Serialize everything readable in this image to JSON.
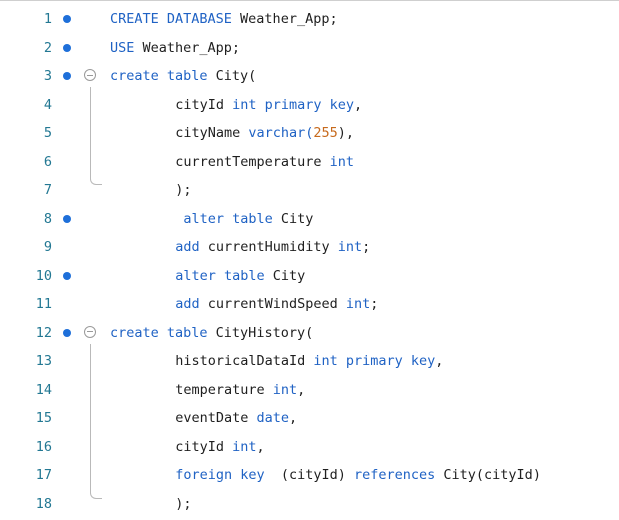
{
  "editor": {
    "lines": [
      {
        "num": "1",
        "dot": true,
        "fold": false,
        "indent": 0,
        "tokens": [
          {
            "t": "CREATE DATABASE",
            "k": "kw"
          },
          {
            "t": " Weather_App;",
            "k": "id"
          }
        ]
      },
      {
        "num": "2",
        "dot": true,
        "fold": false,
        "indent": 0,
        "tokens": [
          {
            "t": "USE",
            "k": "kw"
          },
          {
            "t": " Weather_App;",
            "k": "id"
          }
        ]
      },
      {
        "num": "3",
        "dot": true,
        "fold": true,
        "indent": 0,
        "tokens": [
          {
            "t": "create table",
            "k": "kw"
          },
          {
            "t": " City(",
            "k": "id"
          }
        ]
      },
      {
        "num": "4",
        "dot": false,
        "fold": false,
        "indent": 8,
        "tokens": [
          {
            "t": "cityId ",
            "k": "id"
          },
          {
            "t": "int primary key",
            "k": "kw"
          },
          {
            "t": ",",
            "k": "id"
          }
        ]
      },
      {
        "num": "5",
        "dot": false,
        "fold": false,
        "indent": 8,
        "tokens": [
          {
            "t": "cityName ",
            "k": "id"
          },
          {
            "t": "varchar(",
            "k": "kw"
          },
          {
            "t": "255",
            "k": "num"
          },
          {
            "t": "),",
            "k": "id"
          }
        ]
      },
      {
        "num": "6",
        "dot": false,
        "fold": false,
        "indent": 8,
        "tokens": [
          {
            "t": "currentTemperature ",
            "k": "id"
          },
          {
            "t": "int",
            "k": "kw"
          }
        ]
      },
      {
        "num": "7",
        "dot": false,
        "fold": false,
        "indent": 8,
        "tokens": [
          {
            "t": ");",
            "k": "id"
          }
        ]
      },
      {
        "num": "8",
        "dot": true,
        "fold": false,
        "indent": 9,
        "tokens": [
          {
            "t": "alter table",
            "k": "kw"
          },
          {
            "t": " City",
            "k": "id"
          }
        ]
      },
      {
        "num": "9",
        "dot": false,
        "fold": false,
        "indent": 8,
        "tokens": [
          {
            "t": "add",
            "k": "kw"
          },
          {
            "t": " currentHumidity ",
            "k": "id"
          },
          {
            "t": "int",
            "k": "kw"
          },
          {
            "t": ";",
            "k": "id"
          }
        ]
      },
      {
        "num": "10",
        "dot": true,
        "fold": false,
        "indent": 8,
        "tokens": [
          {
            "t": "alter table",
            "k": "kw"
          },
          {
            "t": " City",
            "k": "id"
          }
        ]
      },
      {
        "num": "11",
        "dot": false,
        "fold": false,
        "indent": 8,
        "tokens": [
          {
            "t": "add",
            "k": "kw"
          },
          {
            "t": " currentWindSpeed ",
            "k": "id"
          },
          {
            "t": "int",
            "k": "kw"
          },
          {
            "t": ";",
            "k": "id"
          }
        ]
      },
      {
        "num": "12",
        "dot": true,
        "fold": true,
        "indent": 0,
        "tokens": [
          {
            "t": "create table",
            "k": "kw"
          },
          {
            "t": " CityHistory(",
            "k": "id"
          }
        ]
      },
      {
        "num": "13",
        "dot": false,
        "fold": false,
        "indent": 8,
        "tokens": [
          {
            "t": "historicalDataId ",
            "k": "id"
          },
          {
            "t": "int primary key",
            "k": "kw"
          },
          {
            "t": ",",
            "k": "id"
          }
        ]
      },
      {
        "num": "14",
        "dot": false,
        "fold": false,
        "indent": 8,
        "tokens": [
          {
            "t": "temperature ",
            "k": "id"
          },
          {
            "t": "int",
            "k": "kw"
          },
          {
            "t": ",",
            "k": "id"
          }
        ]
      },
      {
        "num": "15",
        "dot": false,
        "fold": false,
        "indent": 8,
        "tokens": [
          {
            "t": "eventDate ",
            "k": "id"
          },
          {
            "t": "date",
            "k": "kw"
          },
          {
            "t": ",",
            "k": "id"
          }
        ]
      },
      {
        "num": "16",
        "dot": false,
        "fold": false,
        "indent": 8,
        "tokens": [
          {
            "t": "cityId ",
            "k": "id"
          },
          {
            "t": "int",
            "k": "kw"
          },
          {
            "t": ",",
            "k": "id"
          }
        ]
      },
      {
        "num": "17",
        "dot": false,
        "fold": false,
        "indent": 8,
        "tokens": [
          {
            "t": "foreign key",
            "k": "kw"
          },
          {
            "t": "  (cityId) ",
            "k": "id"
          },
          {
            "t": "references",
            "k": "kw"
          },
          {
            "t": " City(cityId)",
            "k": "id"
          }
        ]
      },
      {
        "num": "18",
        "dot": false,
        "fold": false,
        "indent": 8,
        "tokens": [
          {
            "t": ");",
            "k": "id"
          }
        ]
      }
    ]
  },
  "colors": {
    "keyword": "#1f62c4",
    "number": "#c76a1d",
    "identifier": "#1f1f1f",
    "line_number": "#237893",
    "breakpoint_dot": "#1e6fd9"
  },
  "icons": {
    "fold": "fold-collapse-icon",
    "statement_marker": "statement-marker-dot-icon"
  }
}
